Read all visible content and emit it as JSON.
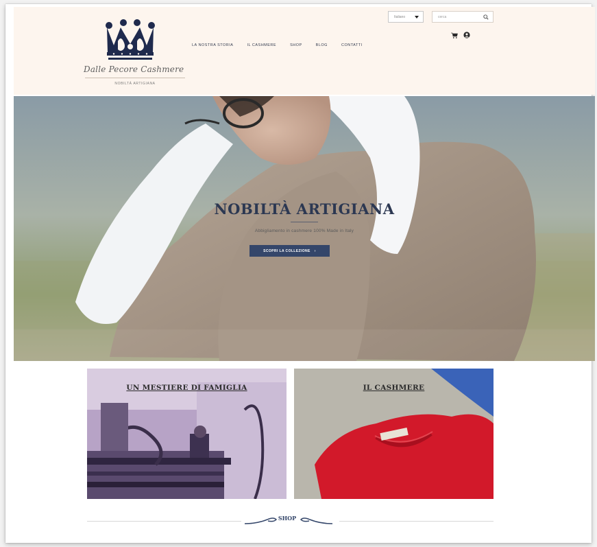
{
  "header": {
    "logo_script": "Dalle Pecore Cashmere",
    "logo_sub": "NOBILTÀ ARTIGIANA",
    "language_select": "Italiano",
    "search_placeholder": "cerca",
    "nav": [
      {
        "label": "LA NOSTRA STORIA"
      },
      {
        "label": "IL CASHMERE"
      },
      {
        "label": "SHOP"
      },
      {
        "label": "BLOG"
      },
      {
        "label": "CONTATTI"
      }
    ]
  },
  "hero": {
    "title": "NOBILTÀ ARTIGIANA",
    "subtitle": "Abbigliamento in cashmere 100% Made in Italy",
    "button_label": "SCOPRI LA COLLEZIONE",
    "button_arrow": "›"
  },
  "tiles": [
    {
      "title": "UN MESTIERE DI FAMIGLIA"
    },
    {
      "title": "IL CASHMERE"
    }
  ],
  "shop_section": {
    "label": "SHOP"
  },
  "icons": [
    "crown-logo-icon",
    "cart-icon",
    "account-icon",
    "search-icon",
    "chevron-down-icon"
  ],
  "colors": {
    "brand_navy": "#34466a",
    "header_bg": "#fdf5ee",
    "sweater_red": "#d2192a"
  }
}
